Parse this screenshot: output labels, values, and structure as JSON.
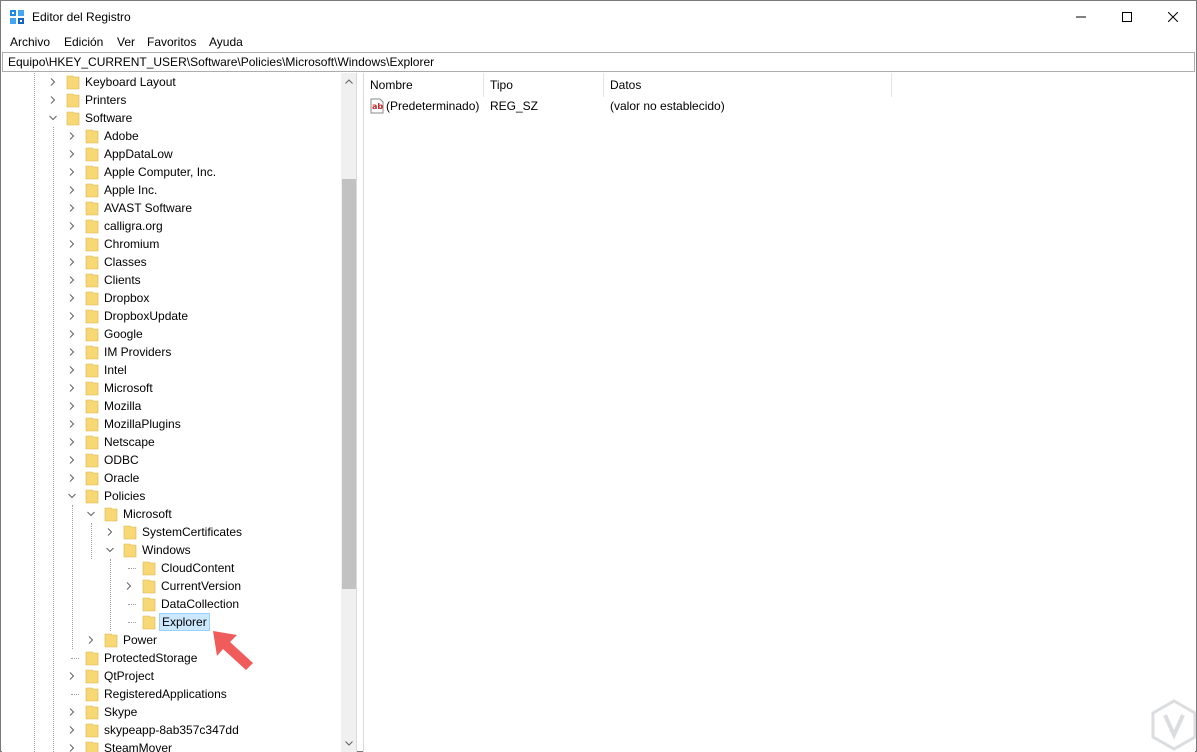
{
  "window": {
    "title": "Editor del Registro",
    "icon": "registry-editor-icon"
  },
  "menu": [
    "Archivo",
    "Edición",
    "Ver",
    "Favoritos",
    "Ayuda"
  ],
  "address": "Equipo\\HKEY_CURRENT_USER\\Software\\Policies\\Microsoft\\Windows\\Explorer",
  "tree": [
    {
      "label": "Keyboard Layout",
      "level": 0,
      "expander": "collapsed"
    },
    {
      "label": "Printers",
      "level": 0,
      "expander": "collapsed"
    },
    {
      "label": "Software",
      "level": 0,
      "expander": "expanded"
    },
    {
      "label": "Adobe",
      "level": 1,
      "expander": "collapsed"
    },
    {
      "label": "AppDataLow",
      "level": 1,
      "expander": "collapsed"
    },
    {
      "label": "Apple Computer, Inc.",
      "level": 1,
      "expander": "collapsed"
    },
    {
      "label": "Apple Inc.",
      "level": 1,
      "expander": "collapsed"
    },
    {
      "label": "AVAST Software",
      "level": 1,
      "expander": "collapsed"
    },
    {
      "label": "calligra.org",
      "level": 1,
      "expander": "collapsed"
    },
    {
      "label": "Chromium",
      "level": 1,
      "expander": "collapsed"
    },
    {
      "label": "Classes",
      "level": 1,
      "expander": "collapsed"
    },
    {
      "label": "Clients",
      "level": 1,
      "expander": "collapsed"
    },
    {
      "label": "Dropbox",
      "level": 1,
      "expander": "collapsed"
    },
    {
      "label": "DropboxUpdate",
      "level": 1,
      "expander": "collapsed"
    },
    {
      "label": "Google",
      "level": 1,
      "expander": "collapsed"
    },
    {
      "label": "IM Providers",
      "level": 1,
      "expander": "collapsed"
    },
    {
      "label": "Intel",
      "level": 1,
      "expander": "collapsed"
    },
    {
      "label": "Microsoft",
      "level": 1,
      "expander": "collapsed"
    },
    {
      "label": "Mozilla",
      "level": 1,
      "expander": "collapsed"
    },
    {
      "label": "MozillaPlugins",
      "level": 1,
      "expander": "collapsed"
    },
    {
      "label": "Netscape",
      "level": 1,
      "expander": "collapsed"
    },
    {
      "label": "ODBC",
      "level": 1,
      "expander": "collapsed"
    },
    {
      "label": "Oracle",
      "level": 1,
      "expander": "collapsed"
    },
    {
      "label": "Policies",
      "level": 1,
      "expander": "expanded"
    },
    {
      "label": "Microsoft",
      "level": 2,
      "expander": "expanded"
    },
    {
      "label": "SystemCertificates",
      "level": 3,
      "expander": "collapsed"
    },
    {
      "label": "Windows",
      "level": 3,
      "expander": "expanded"
    },
    {
      "label": "CloudContent",
      "level": 4,
      "expander": "none"
    },
    {
      "label": "CurrentVersion",
      "level": 4,
      "expander": "collapsed"
    },
    {
      "label": "DataCollection",
      "level": 4,
      "expander": "none"
    },
    {
      "label": "Explorer",
      "level": 4,
      "expander": "none",
      "selected": true
    },
    {
      "label": "Power",
      "level": 2,
      "expander": "collapsed"
    },
    {
      "label": "ProtectedStorage",
      "level": 1,
      "expander": "none"
    },
    {
      "label": "QtProject",
      "level": 1,
      "expander": "collapsed"
    },
    {
      "label": "RegisteredApplications",
      "level": 1,
      "expander": "none"
    },
    {
      "label": "Skype",
      "level": 1,
      "expander": "collapsed"
    },
    {
      "label": "skypeapp-8ab357c347dd",
      "level": 1,
      "expander": "collapsed"
    },
    {
      "label": "SteamMover",
      "level": 1,
      "expander": "collapsed"
    }
  ],
  "list": {
    "columns": [
      "Nombre",
      "Tipo",
      "Datos"
    ],
    "rows": [
      {
        "icon": "string-value-icon",
        "name": "(Predeterminado)",
        "type": "REG_SZ",
        "data": "(valor no establecido)"
      }
    ]
  },
  "colors": {
    "selection_bg": "#cce8ff",
    "folder": "#f8d775",
    "arrow": "#f05b5b"
  }
}
